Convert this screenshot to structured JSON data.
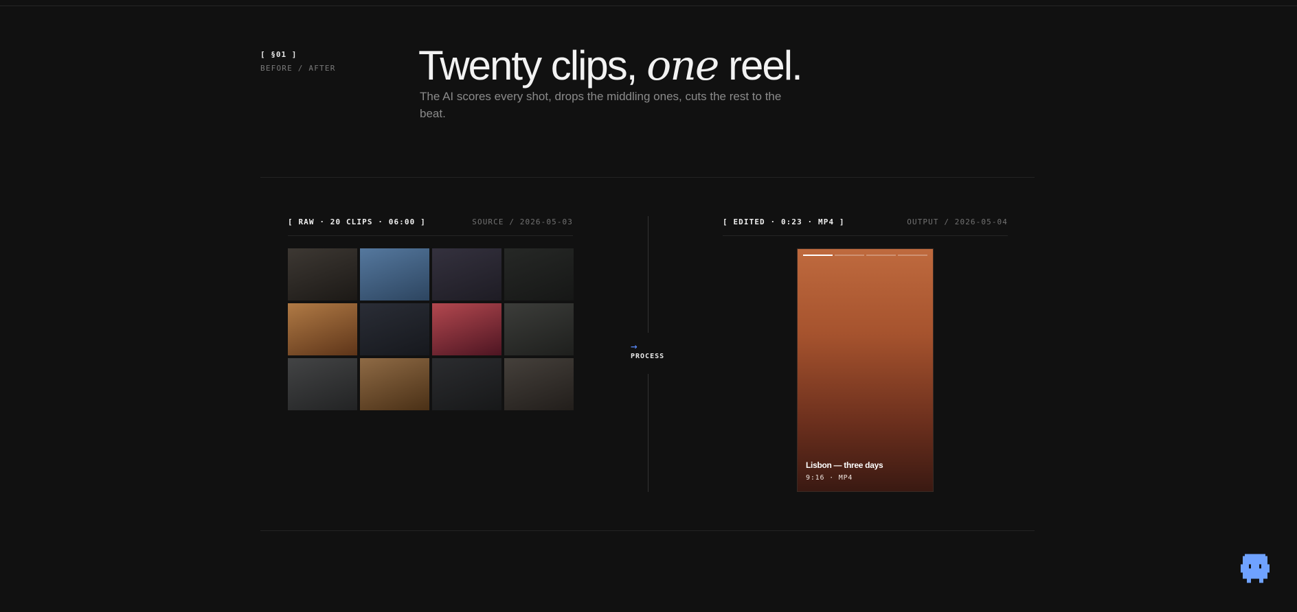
{
  "section": {
    "number": "[ §01 ]",
    "label": "BEFORE / AFTER"
  },
  "headline": {
    "part1": "Twenty clips,",
    "emphasis": "one",
    "part2": "reel."
  },
  "subtitle": "The AI scores every shot, drops the middling ones, cuts the rest to the beat.",
  "raw_panel": {
    "tag": "[ RAW · 20 CLIPS · 06:00 ]",
    "meta": "SOURCE / 2026-05-03",
    "clip_colors": [
      [
        "#3d3833",
        "#1c1916"
      ],
      [
        "#55789e",
        "#2d4560"
      ],
      [
        "#34313e",
        "#1e1c24"
      ],
      [
        "#262826",
        "#161716"
      ],
      [
        "#b07a45",
        "#5e3519"
      ],
      [
        "#2a2d36",
        "#16181d"
      ],
      [
        "#b3484f",
        "#4d1522"
      ],
      [
        "#3c3d3a",
        "#1e1f1d"
      ],
      [
        "#434445",
        "#222324"
      ],
      [
        "#8e6a45",
        "#4a3016"
      ],
      [
        "#2b2c2f",
        "#171819"
      ],
      [
        "#45403b",
        "#221e1b"
      ]
    ]
  },
  "process": {
    "arrow": "→",
    "label": "PROCESS"
  },
  "edited_panel": {
    "tag": "[ EDITED · 0:23 · MP4 ]",
    "meta": "OUTPUT / 2026-05-04",
    "reel_title": "Lisbon — three days",
    "reel_meta": "9:16 · MP4",
    "progress_segments": 4,
    "active_segment": 1
  },
  "colors": {
    "background": "#111111",
    "accent": "#5b8cff",
    "mascot": "#6fa2ff"
  },
  "icons": {
    "process_arrow": "right-arrow-icon",
    "mascot": "pixel-ghost-mascot-icon"
  }
}
